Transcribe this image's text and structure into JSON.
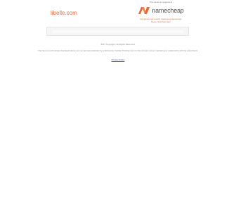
{
  "domain": {
    "name": "libelle.com"
  },
  "registrar": {
    "caption": "This domain is registered at",
    "name": "namecheap",
    "logo_color": "#e8683a",
    "note_line1": "This domain was recently registered at Namecheap.",
    "note_line2": "Please check back later!"
  },
  "search": {
    "placeholder": ""
  },
  "footer": {
    "copyright": "2017 Copyright. All Rights Reserved.",
    "disclaimer": "The Sponsored Listings displayed above are served automatically by a third party. Neither Parkingcrew nor the domain owner maintain any relationship with the advertisers.",
    "privacy_label": "Privacy Policy"
  },
  "colors": {
    "accent": "#e8683a",
    "link": "#3a6fb0",
    "muted_text": "#8a8a8a"
  }
}
